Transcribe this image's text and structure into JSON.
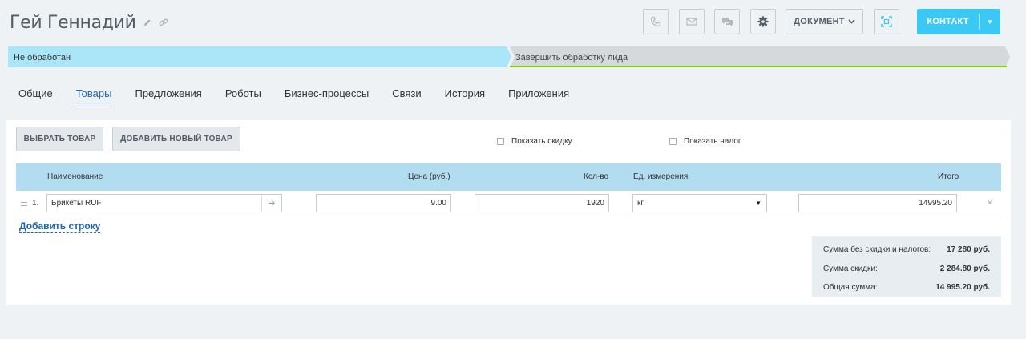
{
  "header": {
    "title": "Гей Геннадий",
    "edit_icon": "pencil-icon",
    "link_icon": "link-icon",
    "actions": {
      "call_icon": "phone-icon",
      "email_icon": "envelope-icon",
      "chat_icon": "chat-icon",
      "settings_icon": "gear-icon",
      "document_label": "ДОКУМЕНТ",
      "scan_icon": "scan-icon",
      "contact_label": "КОНТАКТ"
    },
    "colors": {
      "accent": "#3bc8f5",
      "link": "#2067b0",
      "stage_active": "#abe5f8",
      "stage_done": "#7bd500"
    }
  },
  "stages": {
    "current": "Не обработан",
    "final": "Завершить обработку лида"
  },
  "tabs": [
    {
      "label": "Общие",
      "active": false
    },
    {
      "label": "Товары",
      "active": true
    },
    {
      "label": "Предложения",
      "active": false
    },
    {
      "label": "Роботы",
      "active": false
    },
    {
      "label": "Бизнес-процессы",
      "active": false
    },
    {
      "label": "Связи",
      "active": false
    },
    {
      "label": "История",
      "active": false
    },
    {
      "label": "Приложения",
      "active": false
    }
  ],
  "products": {
    "select_button": "ВЫБРАТЬ ТОВАР",
    "add_new_button": "ДОБАВИТЬ НОВЫЙ ТОВАР",
    "show_discount": "Показать скидку",
    "show_tax": "Показать налог",
    "columns": {
      "name": "Наименование",
      "price": "Цена (руб.)",
      "qty": "Кол-во",
      "unit": "Ед. измерения",
      "total": "Итого"
    },
    "rows": [
      {
        "num": "1.",
        "name": "Брикеты RUF",
        "price": "9.00",
        "qty": "1920",
        "unit": "кг",
        "total": "14995.20",
        "delete": "×"
      }
    ],
    "add_row": "Добавить строку",
    "totals": [
      {
        "label": "Сумма без скидки и налогов:",
        "value": "17 280 руб."
      },
      {
        "label": "Сумма скидки:",
        "value": "2 284.80 руб."
      },
      {
        "label": "Общая сумма:",
        "value": "14 995.20 руб."
      }
    ]
  }
}
